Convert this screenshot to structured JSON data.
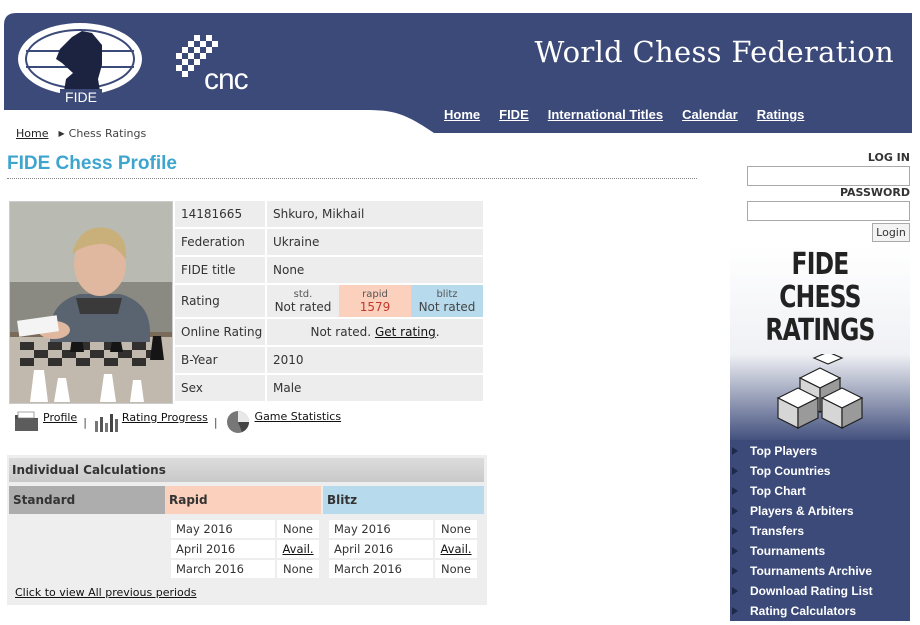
{
  "header": {
    "site_title": "World Chess Federation",
    "fide_logo_text": "FIDE",
    "cnc_logo_text": "CNC",
    "nav": [
      "Home",
      "FIDE",
      "International Titles",
      "Calendar",
      "Ratings"
    ],
    "brand_color": "#3c4a79"
  },
  "breadcrumb": {
    "home": "Home",
    "current": "Chess Ratings"
  },
  "page_title": "FIDE Chess Profile",
  "profile": {
    "fide_id": "14181665",
    "name": "Shkuro, Mikhail",
    "federation_label": "Federation",
    "federation": "Ukraine",
    "title_label": "FIDE title",
    "title": "None",
    "rating_label": "Rating",
    "ratings": {
      "std_label": "std.",
      "std_value": "Not rated",
      "rapid_label": "rapid",
      "rapid_value": "1579",
      "blitz_label": "blitz",
      "blitz_value": "Not rated"
    },
    "online_label": "Online Rating",
    "online_text": "Not rated.",
    "online_link": "Get rating",
    "online_suffix": ".",
    "byear_label": "B-Year",
    "byear": "2010",
    "sex_label": "Sex",
    "sex": "Male"
  },
  "profile_links": {
    "profile": "Profile",
    "rating_progress": "Rating Progress",
    "game_statistics": "Game Statistics",
    "separator": "|"
  },
  "calculations": {
    "title": "Individual Calculations",
    "columns": {
      "standard": "Standard",
      "rapid": "Rapid",
      "blitz": "Blitz"
    },
    "rapid": [
      {
        "month": "May 2016",
        "value": "None"
      },
      {
        "month": "April 2016",
        "value": "Avail."
      },
      {
        "month": "March 2016",
        "value": "None"
      }
    ],
    "blitz": [
      {
        "month": "May 2016",
        "value": "None"
      },
      {
        "month": "April 2016",
        "value": "Avail."
      },
      {
        "month": "March 2016",
        "value": "None"
      }
    ],
    "view_all": "Click to view All previous periods"
  },
  "sidebar": {
    "login_label": "LOG IN",
    "password_label": "PASSWORD",
    "login_button": "Login",
    "banner_text": [
      "FIDE",
      "CHESS",
      "RATINGS"
    ],
    "menu": [
      "Top Players",
      "Top Countries",
      "Top Chart",
      "Players & Arbiters",
      "Transfers",
      "Tournaments",
      "Tournaments Archive",
      "Download Rating List",
      "Rating Calculators"
    ]
  }
}
